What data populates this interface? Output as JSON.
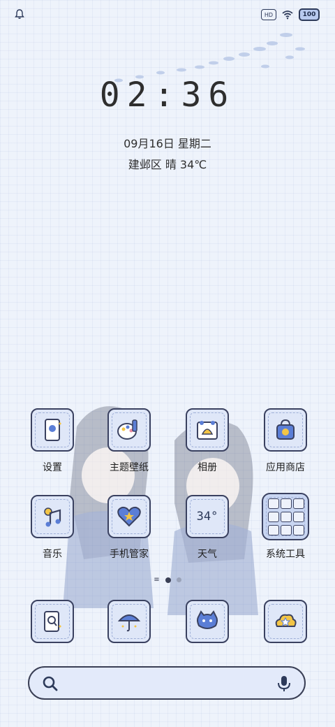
{
  "status_bar": {
    "left_icons": [
      "notification-bell-icon"
    ],
    "hd_label": "HD",
    "battery_level": "100"
  },
  "lockscreen": {
    "time": "02:36",
    "date": "09月16日 星期二",
    "weather": "建邺区 晴 34℃"
  },
  "apps": [
    {
      "label": "设置",
      "icon": "settings-phone-icon"
    },
    {
      "label": "主题壁纸",
      "icon": "theme-palette-icon"
    },
    {
      "label": "相册",
      "icon": "gallery-shell-icon"
    },
    {
      "label": "应用商店",
      "icon": "app-store-bag-icon"
    },
    {
      "label": "音乐",
      "icon": "music-note-icon"
    },
    {
      "label": "手机管家",
      "icon": "phone-manager-heart-icon"
    },
    {
      "label": "天气",
      "icon": "weather-icon",
      "temp": "34°"
    },
    {
      "label": "系统工具",
      "icon": "system-tools-folder-icon"
    }
  ],
  "dock": [
    {
      "icon": "contacts-icon"
    },
    {
      "icon": "umbrella-icon"
    },
    {
      "icon": "cat-messages-icon"
    },
    {
      "icon": "flower-cloud-icon"
    }
  ],
  "colors": {
    "background": "#eef3fb",
    "icon_fill": "#dfe7f8",
    "icon_border": "#3a4160",
    "accent_blue": "#5b7ed6",
    "accent_yellow": "#f3c546"
  }
}
